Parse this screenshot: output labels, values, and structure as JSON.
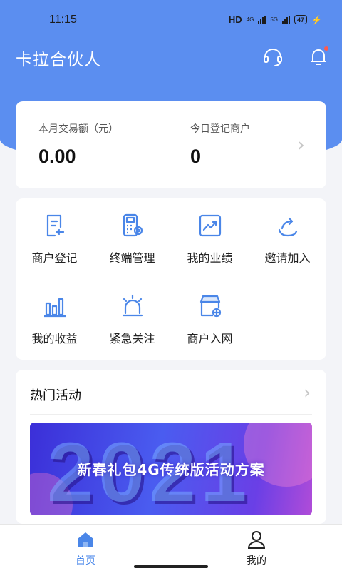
{
  "status_bar": {
    "time": "11:15",
    "network": "HD",
    "net_a": "4G",
    "net_b": "5G",
    "battery": "47"
  },
  "header": {
    "title": "卡拉合伙人",
    "icons": [
      "headset-icon",
      "bell-icon"
    ]
  },
  "stats": {
    "monthly_label": "本月交易额（元）",
    "monthly_value": "0.00",
    "today_label": "今日登记商户",
    "today_value": "0"
  },
  "grid": [
    {
      "label": "商户登记",
      "icon": "merchant-register-icon"
    },
    {
      "label": "终端管理",
      "icon": "terminal-manage-icon"
    },
    {
      "label": "我的业绩",
      "icon": "performance-chart-icon"
    },
    {
      "label": "邀请加入",
      "icon": "share-invite-icon"
    },
    {
      "label": "我的收益",
      "icon": "earnings-bars-icon"
    },
    {
      "label": "紧急关注",
      "icon": "alarm-light-icon"
    },
    {
      "label": "商户入网",
      "icon": "store-add-icon"
    }
  ],
  "activities": {
    "title": "热门活动",
    "banner_year": "2021",
    "banner_text": "新春礼包4G传统版活动方案"
  },
  "tabs": [
    {
      "label": "首页",
      "icon": "home-icon",
      "active": true
    },
    {
      "label": "我的",
      "icon": "user-icon",
      "active": false
    }
  ],
  "colors": {
    "primary": "#5b8ef0",
    "accent": "#3b7ee8",
    "icon_blue": "#4a86e8",
    "badge": "#ff5a4d"
  }
}
